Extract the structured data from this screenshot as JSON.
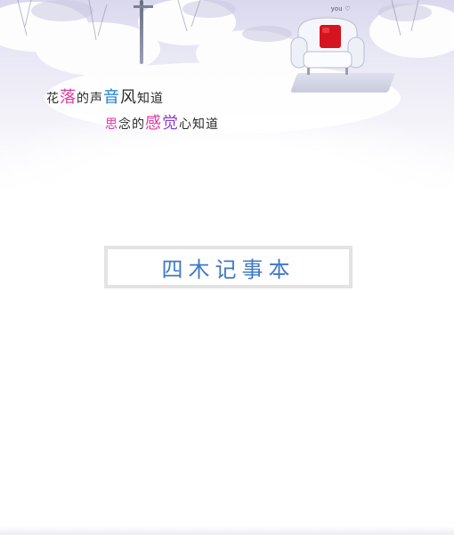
{
  "header": {
    "brand_mark": "you ♡",
    "poem_line_1": [
      "花",
      "落",
      "的",
      "声",
      "音",
      "风",
      "知",
      "道"
    ],
    "poem_line_2": [
      "思",
      "念",
      "的",
      "感",
      "觉",
      "心",
      "知",
      "道"
    ]
  },
  "main": {
    "title": "四木记事本"
  },
  "colors": {
    "title_text": "#3f78c9",
    "title_border": "#e3e3e3",
    "accent_pink": "#e0379f",
    "accent_blue": "#1a7ed8",
    "accent_purple": "#8a3fd6",
    "cushion_red": "#d6141f"
  }
}
